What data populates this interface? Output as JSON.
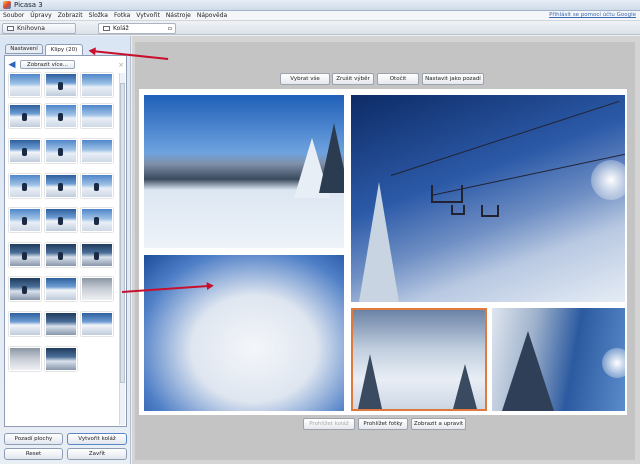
{
  "app": {
    "title": "Picasa 3"
  },
  "menu": {
    "items": [
      "Soubor",
      "Úpravy",
      "Zobrazit",
      "Složka",
      "Fotka",
      "Vytvořit",
      "Nástroje",
      "Nápověda"
    ],
    "help_link": "Přihlásit se pomocí účtu Google"
  },
  "tabs": {
    "library": "Knihovna",
    "collage": "Koláž"
  },
  "left_panel": {
    "tabs": [
      "Nastavení",
      "Klipy (20)"
    ],
    "back_label": "Zobrazit více...",
    "bottom_buttons": [
      "Pozadí plochy",
      "Vytvořit koláž",
      "Reset",
      "Zavřít"
    ]
  },
  "collage_toolbar": {
    "buttons": [
      "Vybrat vše",
      "Zrušit výběr",
      "Otočit",
      "Nastavit jako pozadí"
    ]
  },
  "bottom_toolbar": {
    "buttons": [
      "Prohlížet koláž",
      "Prohlížet fotky",
      "Zobrazit a upravit"
    ]
  },
  "icons": [
    "picasa-logo-icon",
    "library-icon",
    "collage-icon",
    "back-arrow-icon",
    "close-icon"
  ],
  "colors": {
    "accent_red": "#c8102e",
    "selection_orange": "#e07a3c"
  }
}
